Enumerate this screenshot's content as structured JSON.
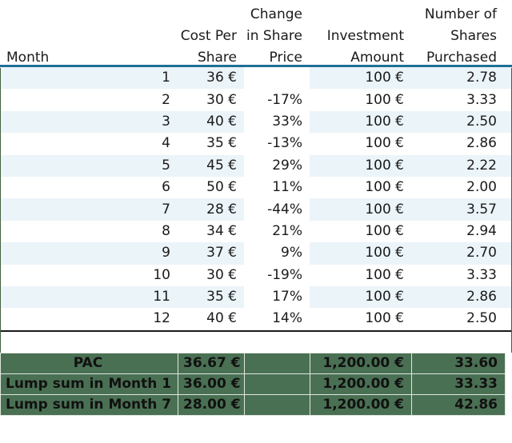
{
  "table": {
    "headers": {
      "month": "Month",
      "cost_per_share": [
        "Cost Per",
        "Share"
      ],
      "change_in_share_price": [
        "Change",
        "in Share",
        "Price"
      ],
      "investment_amount": [
        "Investment",
        "Amount"
      ],
      "number_of_shares": [
        "Number of",
        "Shares",
        "Purchased"
      ]
    },
    "rows": [
      {
        "month": "1",
        "cost": "36 €",
        "change": "",
        "investment": "100 €",
        "shares": "2.78"
      },
      {
        "month": "2",
        "cost": "30 €",
        "change": "-17%",
        "investment": "100 €",
        "shares": "3.33"
      },
      {
        "month": "3",
        "cost": "40 €",
        "change": "33%",
        "investment": "100 €",
        "shares": "2.50"
      },
      {
        "month": "4",
        "cost": "35 €",
        "change": "-13%",
        "investment": "100 €",
        "shares": "2.86"
      },
      {
        "month": "5",
        "cost": "45 €",
        "change": "29%",
        "investment": "100 €",
        "shares": "2.22"
      },
      {
        "month": "6",
        "cost": "50 €",
        "change": "11%",
        "investment": "100 €",
        "shares": "2.00"
      },
      {
        "month": "7",
        "cost": "28 €",
        "change": "-44%",
        "investment": "100 €",
        "shares": "3.57"
      },
      {
        "month": "8",
        "cost": "34 €",
        "change": "21%",
        "investment": "100 €",
        "shares": "2.94"
      },
      {
        "month": "9",
        "cost": "37 €",
        "change": "9%",
        "investment": "100 €",
        "shares": "2.70"
      },
      {
        "month": "10",
        "cost": "30 €",
        "change": "-19%",
        "investment": "100 €",
        "shares": "3.33"
      },
      {
        "month": "11",
        "cost": "35 €",
        "change": "17%",
        "investment": "100 €",
        "shares": "2.86"
      },
      {
        "month": "12",
        "cost": "40 €",
        "change": "14%",
        "investment": "100 €",
        "shares": "2.50"
      }
    ],
    "summary": [
      {
        "label": "PAC",
        "cost": "36.67 €",
        "change": "",
        "investment": "1,200.00 €",
        "shares": "33.60"
      },
      {
        "label": "Lump sum in Month 1",
        "cost": "36.00 €",
        "change": "",
        "investment": "1,200.00 €",
        "shares": "33.33"
      },
      {
        "label": "Lump sum in Month 7",
        "cost": "28.00 €",
        "change": "",
        "investment": "1,200.00 €",
        "shares": "42.86"
      }
    ]
  },
  "colors": {
    "header_rule": "#1f6f96",
    "band": "#ebf4f9",
    "summary_bg": "#4a7053",
    "edge_border": "#43603f",
    "bottom_rule": "#1a1a1a"
  }
}
